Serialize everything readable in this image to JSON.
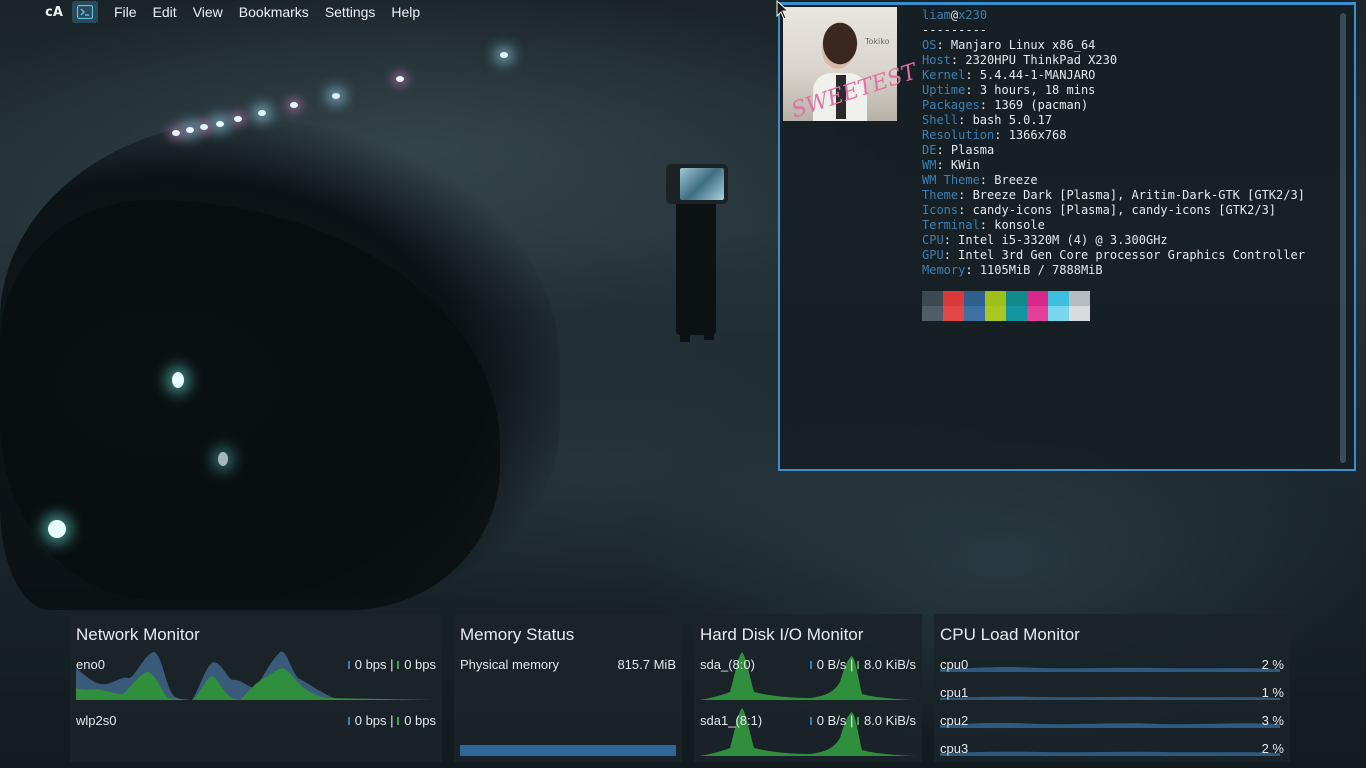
{
  "menubar": {
    "app_logo": "cA",
    "items": [
      "File",
      "Edit",
      "View",
      "Bookmarks",
      "Settings",
      "Help"
    ]
  },
  "terminal": {
    "user": "liam",
    "at": "@",
    "host": "x230",
    "separator": "---------",
    "info": [
      {
        "key": "OS",
        "value": "Manjaro Linux x86_64"
      },
      {
        "key": "Host",
        "value": "2320HPU ThinkPad X230"
      },
      {
        "key": "Kernel",
        "value": "5.4.44-1-MANJARO"
      },
      {
        "key": "Uptime",
        "value": "3 hours, 18 mins"
      },
      {
        "key": "Packages",
        "value": "1369 (pacman)"
      },
      {
        "key": "Shell",
        "value": "bash 5.0.17"
      },
      {
        "key": "Resolution",
        "value": "1366x768"
      },
      {
        "key": "DE",
        "value": "Plasma"
      },
      {
        "key": "WM",
        "value": "KWin"
      },
      {
        "key": "WM Theme",
        "value": "Breeze"
      },
      {
        "key": "Theme",
        "value": "Breeze Dark [Plasma], Aritim-Dark-GTK [GTK2/3]"
      },
      {
        "key": "Icons",
        "value": "candy-icons [Plasma], candy-icons [GTK2/3]"
      },
      {
        "key": "Terminal",
        "value": "konsole"
      },
      {
        "key": "CPU",
        "value": "Intel i5-3320M (4) @ 3.300GHz"
      },
      {
        "key": "GPU",
        "value": "Intel 3rd Gen Core processor Graphics Controller"
      },
      {
        "key": "Memory",
        "value": "1105MiB / 7888MiB"
      }
    ],
    "palette_top": [
      "#3b4a52",
      "#d93a3a",
      "#2f5f8f",
      "#9fbf1a",
      "#108a8a",
      "#d9288a",
      "#3fbfe0",
      "#b6bcc0"
    ],
    "palette_bottom": [
      "#4f5e66",
      "#e14848",
      "#3d70a4",
      "#a8c81e",
      "#1496a0",
      "#e2409a",
      "#78d6ee",
      "#d8dcdf"
    ],
    "album_text": "SWEETEST",
    "album_tag": "Tokiko"
  },
  "widgets": {
    "network": {
      "title": "Network Monitor",
      "interfaces": [
        {
          "name": "eno0",
          "down": "0 bps",
          "sep": "|",
          "up": "0 bps"
        },
        {
          "name": "wlp2s0",
          "down": "0 bps",
          "sep": "|",
          "up": "0 bps"
        }
      ]
    },
    "memory": {
      "title": "Memory Status",
      "label": "Physical memory",
      "value": "815.7 MiB"
    },
    "disk": {
      "title": "Hard Disk I/O Monitor",
      "devices": [
        {
          "name": "sda_(8:0)",
          "read": "0 B/s",
          "sep": "|",
          "write": "8.0 KiB/s"
        },
        {
          "name": "sda1_(8:1)",
          "read": "0 B/s",
          "sep": "|",
          "write": "8.0 KiB/s"
        }
      ]
    },
    "cpu": {
      "title": "CPU Load Monitor",
      "cores": [
        {
          "name": "cpu0",
          "load": "2 %"
        },
        {
          "name": "cpu1",
          "load": "1 %"
        },
        {
          "name": "cpu2",
          "load": "3 %"
        },
        {
          "name": "cpu3",
          "load": "2 %"
        }
      ]
    }
  },
  "colors": {
    "accent": "#3a8fd0",
    "series_blue": "#3f7fb2",
    "series_green": "#3ea64a"
  }
}
